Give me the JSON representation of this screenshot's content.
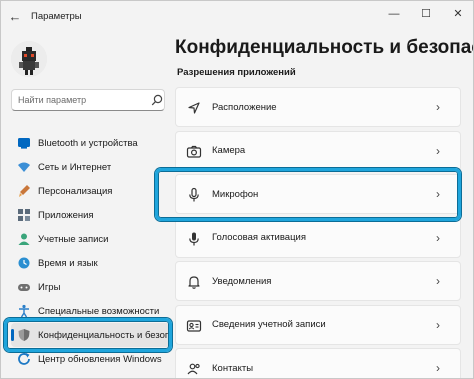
{
  "window": {
    "title": "Параметры",
    "back": "←",
    "controls": {
      "minimize": "—",
      "maximize": "☐",
      "close": "✕"
    }
  },
  "search": {
    "placeholder": "Найти параметр"
  },
  "sidebar": {
    "items": [
      {
        "label": "Bluetooth и устройства",
        "icon": "bluetooth-icon",
        "color": "#0067c0"
      },
      {
        "label": "Сеть и Интернет",
        "icon": "wifi-icon",
        "color": "#3b8fd6"
      },
      {
        "label": "Персонализация",
        "icon": "brush-icon",
        "color": "#c9773a"
      },
      {
        "label": "Приложения",
        "icon": "apps-icon",
        "color": "#5a6a7a"
      },
      {
        "label": "Учетные записи",
        "icon": "person-icon",
        "color": "#3aa57b"
      },
      {
        "label": "Время и язык",
        "icon": "globe-time-icon",
        "color": "#2b8fd1"
      },
      {
        "label": "Игры",
        "icon": "gamepad-icon",
        "color": "#707070"
      },
      {
        "label": "Специальные возможности",
        "icon": "accessibility-icon",
        "color": "#2b7fc9"
      },
      {
        "label": "Конфиденциальность и безопасность",
        "icon": "shield-icon",
        "color": "#808080",
        "selected": true
      },
      {
        "label": "Центр обновления Windows",
        "icon": "update-icon",
        "color": "#1c78c4"
      }
    ]
  },
  "main": {
    "title": "Конфиденциальность и безопасность",
    "section": "Разрешения приложений",
    "items": [
      {
        "label": "Расположение",
        "icon": "location-icon"
      },
      {
        "label": "Камера",
        "icon": "camera-icon"
      },
      {
        "label": "Микрофон",
        "icon": "microphone-icon",
        "highlighted": true
      },
      {
        "label": "Голосовая активация",
        "icon": "voice-activation-icon"
      },
      {
        "label": "Уведомления",
        "icon": "bell-icon"
      },
      {
        "label": "Сведения учетной записи",
        "icon": "account-info-icon"
      },
      {
        "label": "Контакты",
        "icon": "contacts-icon"
      }
    ],
    "chevron": "›"
  },
  "colors": {
    "accent": "#0067c0",
    "highlight": "#1fa5dc"
  }
}
